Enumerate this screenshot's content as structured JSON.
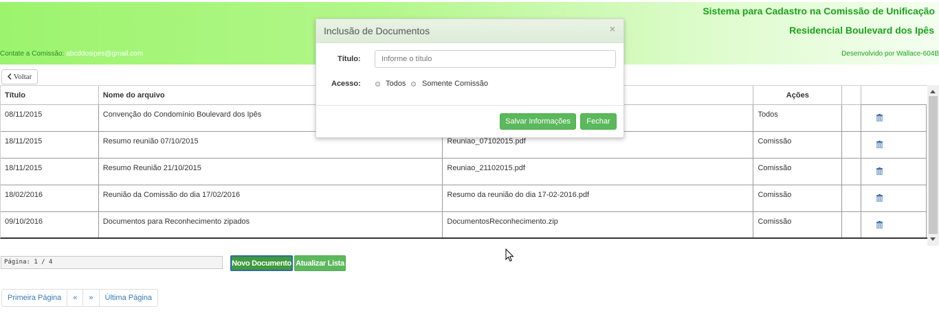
{
  "header": {
    "title": "Sistema para Cadastro na Comissão de Unificação",
    "subtitle": "Residencial Boulevard dos Ipês",
    "contact_label": "Contate a Comissão:",
    "contact_email": "abcddosipes@gmail.com",
    "developer": "Desenvolvido por Wallace-604B",
    "colors": {
      "brand_green": "#19a319",
      "header_gradient_start": "#9cf46d"
    }
  },
  "back_button": {
    "label": "Voltar",
    "icon": "chevron-left-icon"
  },
  "table": {
    "columns": [
      "Título",
      "Nome do arquivo",
      "",
      "Ações"
    ],
    "rows": [
      {
        "date": "08/11/2015",
        "name": "Convenção do Condomínio Boulevard dos Ipês",
        "file": "",
        "access": "Todos"
      },
      {
        "date": "18/11/2015",
        "name": "Resumo reunião 07/10/2015",
        "file": "Reuniao_07102015.pdf",
        "access": "Comissão"
      },
      {
        "date": "18/11/2015",
        "name": "Resumo Reunião 21/10/2015",
        "file": "Reuniao_21102015.pdf",
        "access": "Comissão"
      },
      {
        "date": "18/02/2016",
        "name": "Reunião da Comissão do dia 17/02/2016",
        "file": "Resumo da reunião do dia 17-02-2016.pdf",
        "access": "Comissão"
      },
      {
        "date": "09/10/2016",
        "name": "Documentos para Reconhecimento zipados",
        "file": "DocumentosReconhecimento.zip",
        "access": "Comissão"
      }
    ],
    "row_action_icon": "trash-icon"
  },
  "pagination": {
    "info": "Página: 1 / 4",
    "new_button": "Novo Documento",
    "refresh_button": "Atualizar Lista",
    "first": "Primeira Página",
    "prev": "«",
    "next": "»",
    "last": "Última Página"
  },
  "modal": {
    "title": "Inclusão de Documentos",
    "close": "×",
    "title_label": "Título:",
    "title_placeholder": "Informe o título",
    "access_label": "Acesso:",
    "access_options": [
      "Todos",
      "Somente Comissão"
    ],
    "save_button": "Salvar Informações",
    "close_button": "Fechar"
  }
}
